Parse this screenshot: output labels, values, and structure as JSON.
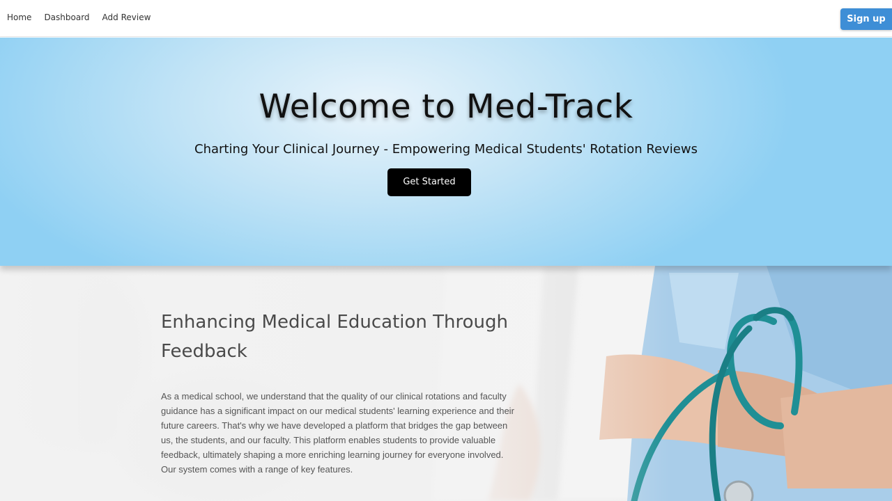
{
  "nav": {
    "links": [
      {
        "label": "Home"
      },
      {
        "label": "Dashboard"
      },
      {
        "label": "Add Review"
      }
    ],
    "signup_label": "Sign up"
  },
  "hero": {
    "title": "Welcome to Med-Track",
    "subtitle": "Charting Your Clinical Journey - Empowering Medical Students' Rotation Reviews",
    "cta_label": "Get Started"
  },
  "feature": {
    "heading": "Enhancing Medical Education Through Feedback",
    "body": "As a medical school, we understand that the quality of our clinical rotations and faculty guidance has a significant impact on our medical students' learning experience and their future careers. That's why we have developed a platform that bridges the gap between us, the students, and our faculty. This platform enables students to provide valuable feedback, ultimately shaping a more enriching learning journey for everyone involved. Our system comes with a range of key features."
  },
  "colors": {
    "signup": "#3e8ed6",
    "hero_bg": "#8fd0f3",
    "stethoscope": "#1f8f95",
    "scrubs": "#9fc7e6"
  }
}
